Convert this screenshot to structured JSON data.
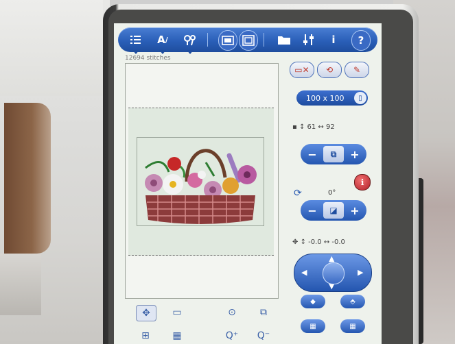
{
  "toolbar": {
    "buttons": [
      {
        "icon": "layout-list-icon"
      },
      {
        "icon": "text-edit-icon",
        "label": "A"
      },
      {
        "icon": "flower-edit-icon"
      },
      {
        "icon": "hoop-view-icon"
      },
      {
        "icon": "frame-view-icon"
      },
      {
        "icon": "folder-icon"
      },
      {
        "icon": "settings-icon"
      },
      {
        "icon": "info-icon",
        "label": "i"
      },
      {
        "icon": "help-icon",
        "label": "?"
      }
    ]
  },
  "stitch_count": "12694 stitches",
  "design": {
    "name": "flower basket embroidery"
  },
  "controls": {
    "size_label": "100 x 100",
    "size_readout": "↕ 61 ↔ 92",
    "minus": "−",
    "plus": "+",
    "rotation_readout": "0°",
    "position_readout": "↕ -0.0 ↔ -0.0"
  },
  "colors": {
    "toolbar_blue": "#2a5fb8",
    "screen_bg": "#eef2ec",
    "hoop_fill": "#e0e9df",
    "accent_red": "#b3202a"
  }
}
